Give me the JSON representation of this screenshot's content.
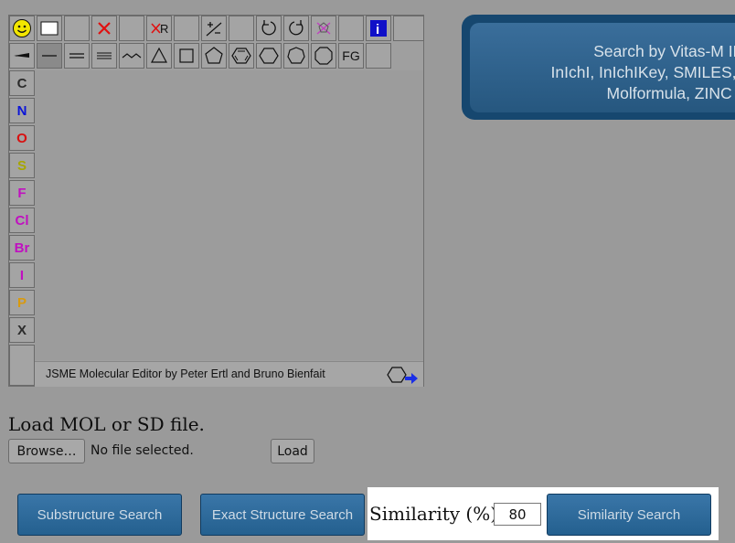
{
  "editor": {
    "toolbar_row1": [
      {
        "name": "smiley-icon"
      },
      {
        "name": "new-document-icon"
      },
      {
        "name": "blank-tool"
      },
      {
        "name": "delete-icon"
      },
      {
        "name": "blank-tool"
      },
      {
        "name": "delete-group-icon",
        "label": "R"
      },
      {
        "name": "blank-tool"
      },
      {
        "name": "charge-icon"
      },
      {
        "name": "blank-tool"
      },
      {
        "name": "undo-icon"
      },
      {
        "name": "redo-icon"
      },
      {
        "name": "clear-icon"
      },
      {
        "name": "blank-tool"
      },
      {
        "name": "info-icon",
        "label": "i"
      },
      {
        "name": "blank-tool"
      }
    ],
    "toolbar_row2": [
      {
        "name": "stereo-bond-icon"
      },
      {
        "name": "single-bond-icon"
      },
      {
        "name": "double-bond-icon"
      },
      {
        "name": "triple-bond-icon"
      },
      {
        "name": "chain-icon"
      },
      {
        "name": "ring3-icon"
      },
      {
        "name": "ring4-icon"
      },
      {
        "name": "ring5-icon"
      },
      {
        "name": "benzene-icon"
      },
      {
        "name": "ring6-icon"
      },
      {
        "name": "ring7-icon"
      },
      {
        "name": "ring8-icon"
      },
      {
        "name": "functional-group-button",
        "label": "FG"
      },
      {
        "name": "blank-tool"
      }
    ],
    "elements": [
      {
        "symbol": "C",
        "color": "#2b2b2b"
      },
      {
        "symbol": "N",
        "color": "#0a14d8"
      },
      {
        "symbol": "O",
        "color": "#d81010"
      },
      {
        "symbol": "S",
        "color": "#a6a600"
      },
      {
        "symbol": "F",
        "color": "#c010c0"
      },
      {
        "symbol": "Cl",
        "color": "#c010c0"
      },
      {
        "symbol": "Br",
        "color": "#c010c0"
      },
      {
        "symbol": "I",
        "color": "#c010c0"
      },
      {
        "symbol": "P",
        "color": "#d89a10"
      },
      {
        "symbol": "X",
        "color": "#2b2b2b"
      }
    ],
    "credit": "JSME Molecular Editor by Peter Ertl and Bruno Bienfait"
  },
  "banner": {
    "line1": "Search by Vitas-M IDs",
    "line2": "InIchI, InIchIKey, SMILES, C",
    "line3": "Molformula, ZINC ID"
  },
  "load": {
    "title": "Load MOL or SD file.",
    "browse_label": "Browse…",
    "file_status": "No file selected.",
    "load_label": "Load"
  },
  "search": {
    "substructure_label": "Substructure Search",
    "exact_label": "Exact Structure Search",
    "similarity_field_label": "Similarity (%):",
    "similarity_value": "80",
    "similarity_button_label": "Similarity Search"
  },
  "colors": {
    "background": "#9a9a9a",
    "button_blue": "#2e6a9a",
    "banner_blue": "#16476f"
  }
}
